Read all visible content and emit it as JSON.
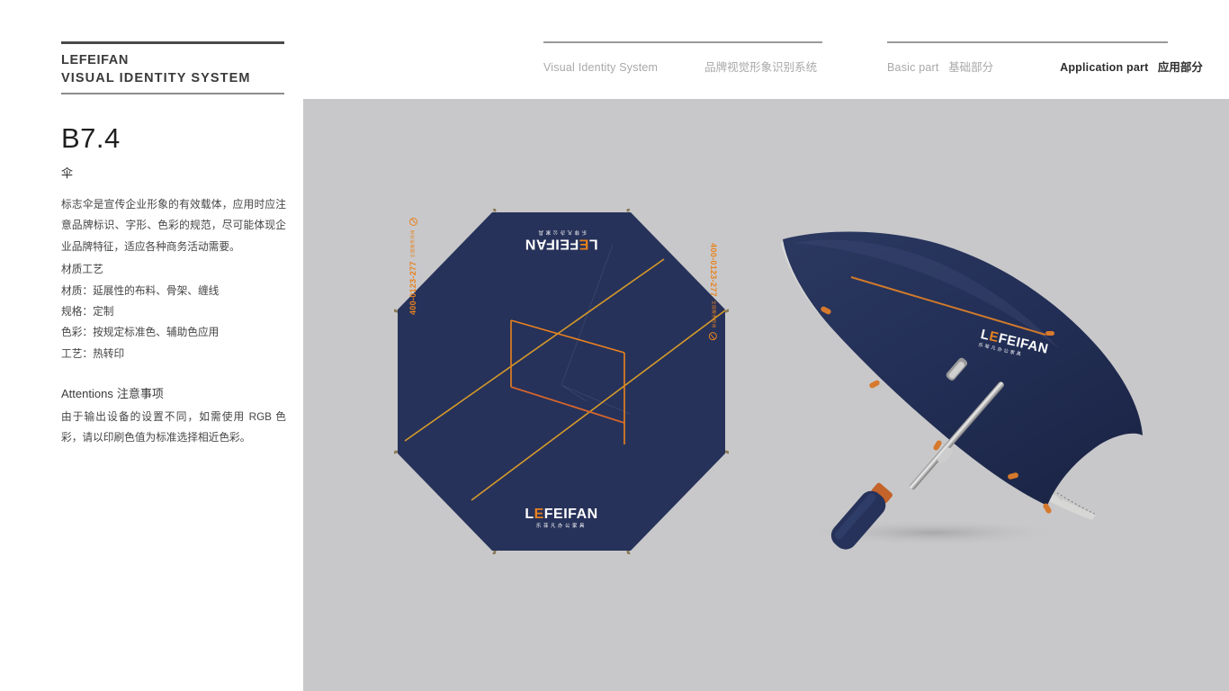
{
  "brand": {
    "name": "LEFEIFAN",
    "subtitle": "VISUAL IDENTITY SYSTEM"
  },
  "nav": {
    "group1": [
      {
        "en": "Visual Identity System",
        "cn": "",
        "active": false
      },
      {
        "en": "",
        "cn": "品牌视觉形象识别系统",
        "active": false
      }
    ],
    "group2": [
      {
        "en": "Basic part",
        "cn": "基础部分",
        "active": false
      },
      {
        "en": "Application part",
        "cn": "应用部分",
        "active": true
      }
    ]
  },
  "sidebar": {
    "section_number": "B7.4",
    "section_title": "伞",
    "intro": "标志伞是宣传企业形象的有效载体，应用时应注意品牌标识、字形、色彩的规范，尽可能体现企业品牌特征，适应各种商务活动需要。",
    "spec_heading": "材质工艺",
    "specs": [
      "材质：延展性的布料、骨架、缠线",
      "规格：定制",
      "色彩：按规定标准色、辅助色应用",
      "工艺：热转印"
    ],
    "attentions_en": "Attentions",
    "attentions_cn": "注意事项",
    "attentions_body": "由于输出设备的设置不同，如需使用 RGB 色彩，请以印刷色值为标准选择相近色彩。"
  },
  "artwork": {
    "logo_word_left": "L",
    "logo_word_accent": "E",
    "logo_word_right": "FEIFAN",
    "logo_tagline": "乐菲凡办公家具",
    "phone_number": "400-0123-277",
    "phone_label": "全国服务热线",
    "colors": {
      "panel_gray": "#c8c8ca",
      "navy": "#27325a",
      "orange": "#e8821e",
      "amber": "#d69a2a",
      "canopy_underside": "#f2f2f0",
      "tip_tan": "#8a7a58"
    }
  }
}
